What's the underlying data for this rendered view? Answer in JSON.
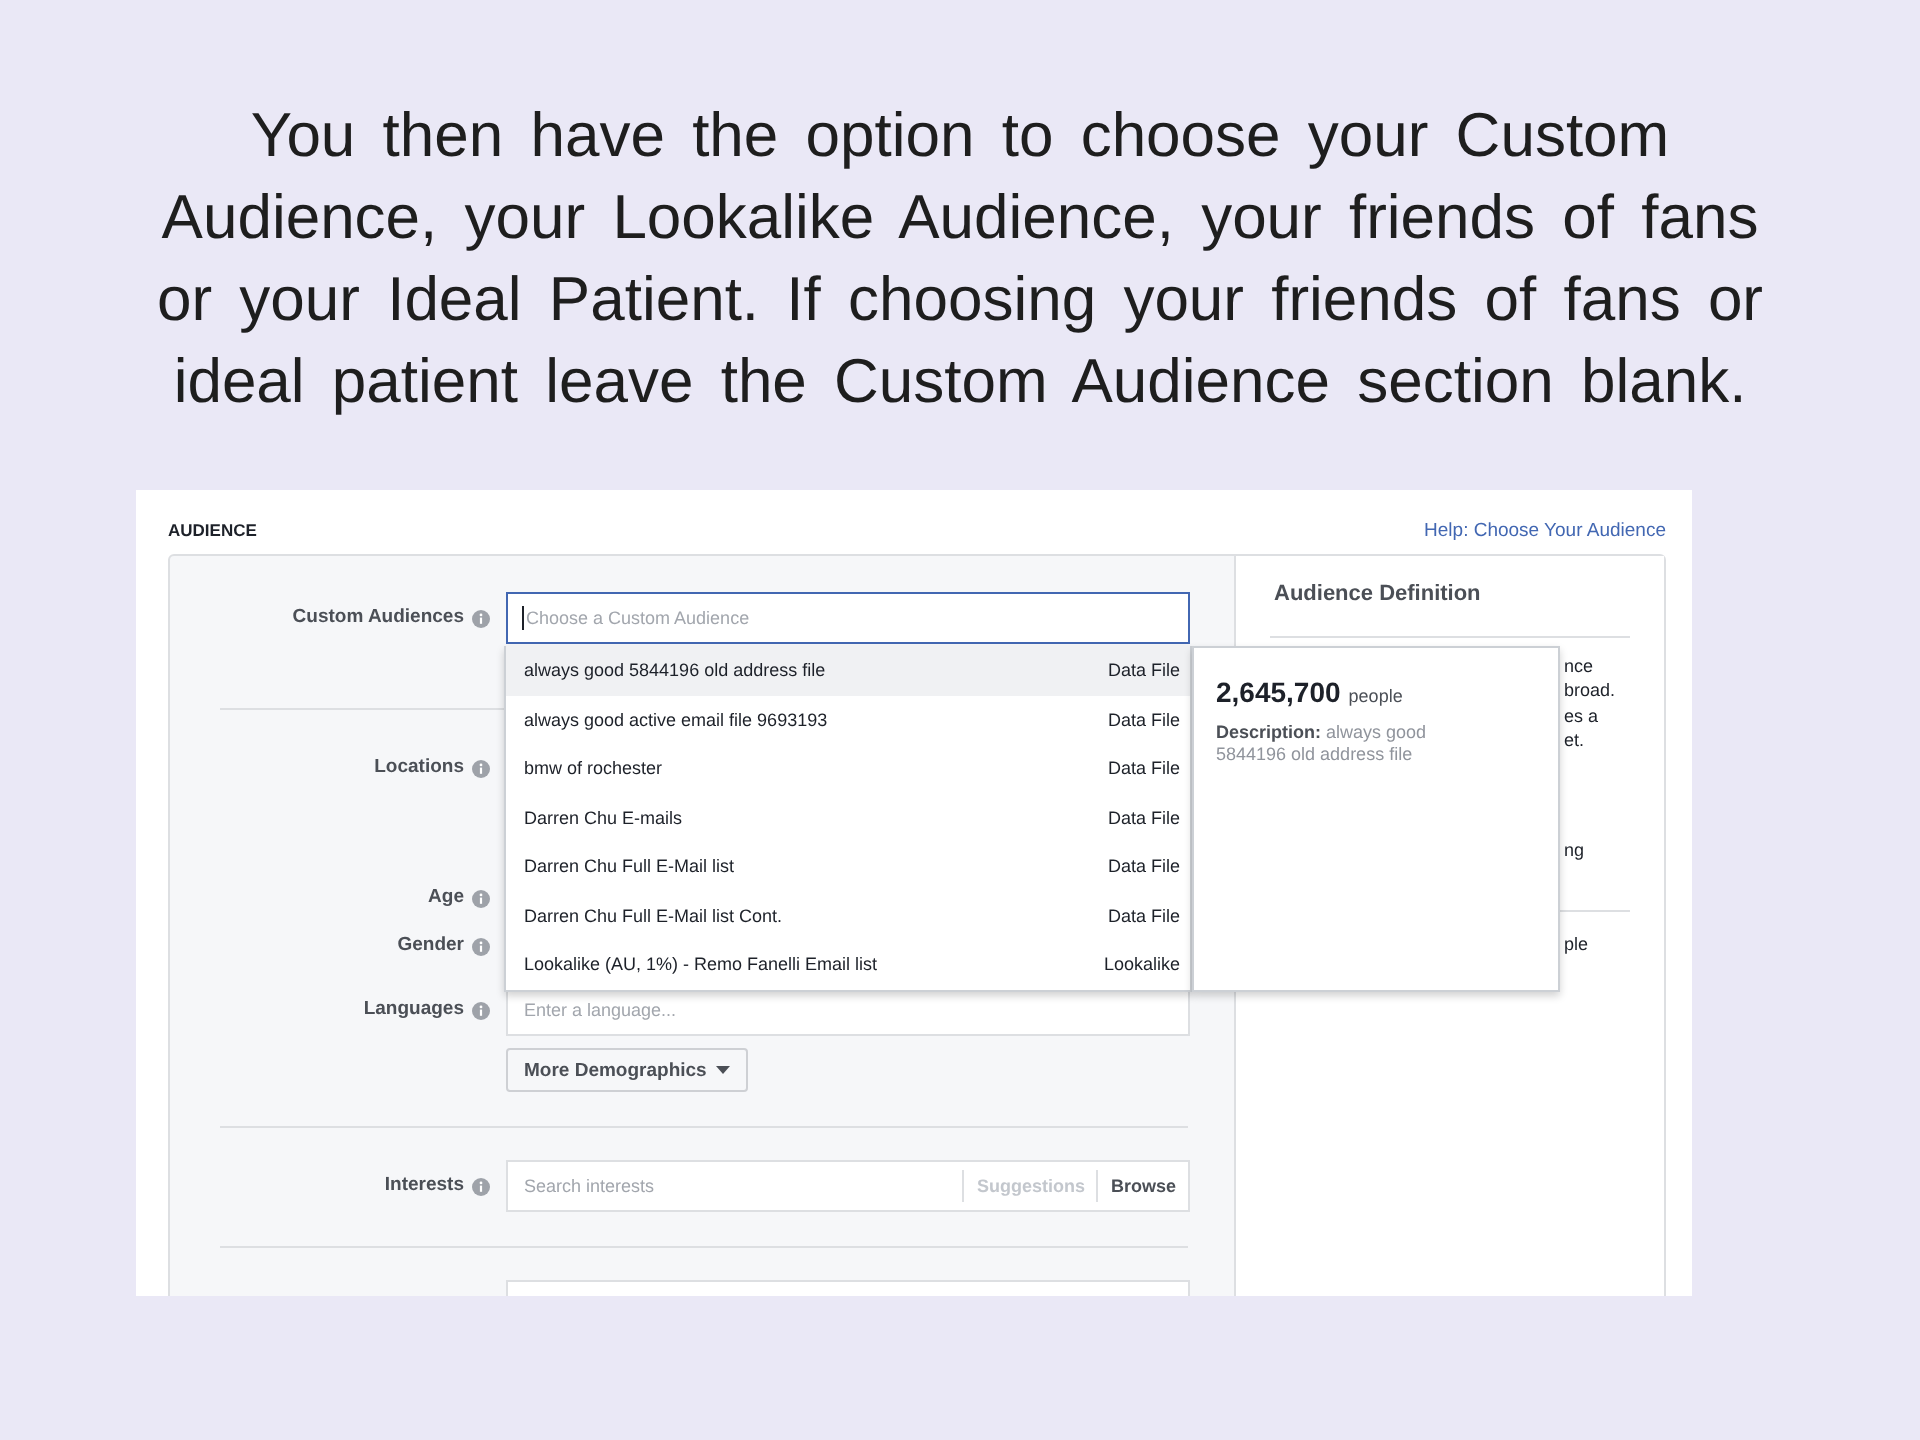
{
  "heading": "You then have the option to choose your Custom Audience, your Lookalike Audience, your friends of fans or your Ideal Patient. If choosing your friends of fans or ideal patient leave the Custom Audience section blank.",
  "screenshot": {
    "section_title": "AUDIENCE",
    "help_link": "Help: Choose Your Audience",
    "form_sections": [
      {
        "rows": [
          {
            "kind": "combobox",
            "label": "Custom Audiences",
            "placeholder": "Choose a Custom Audience",
            "focused": true,
            "options": [
              {
                "name": "always good 5844196 old address file",
                "type": "Data File",
                "selected": true
              },
              {
                "name": "always good active email file 9693193",
                "type": "Data File",
                "selected": false
              },
              {
                "name": "bmw of rochester",
                "type": "Data File",
                "selected": false
              },
              {
                "name": "Darren Chu E-mails",
                "type": "Data File",
                "selected": false
              },
              {
                "name": "Darren Chu Full E-Mail list",
                "type": "Data File",
                "selected": false
              },
              {
                "name": "Darren Chu Full E-Mail list Cont.",
                "type": "Data File",
                "selected": false
              },
              {
                "name": "Lookalike (AU, 1%) - Remo Fanelli Email list",
                "type": "Lookalike",
                "selected": false
              }
            ],
            "detail": {
              "count": "2,645,700",
              "unit": "people",
              "description": "**Description:** always good 5844196 old address file"
            }
          }
        ]
      },
      {
        "rows": [
          {
            "kind": "covered",
            "label": "Locations"
          },
          {
            "kind": "covered",
            "label": "Age"
          },
          {
            "kind": "covered",
            "label": "Gender"
          },
          {
            "kind": "input",
            "label": "Languages",
            "placeholder": "Enter a language..."
          },
          {
            "kind": "menu_button",
            "text": "More Demographics"
          }
        ]
      },
      {
        "rows": [
          {
            "kind": "search_browse",
            "label": "Interests",
            "placeholder": "Search interests",
            "actions": [
              {
                "text": "Suggestions",
                "disabled": true
              },
              {
                "text": "Browse",
                "disabled": false
              }
            ]
          }
        ]
      },
      {
        "rows": [
          {
            "kind": "clipped"
          }
        ]
      }
    ],
    "definition": {
      "title": "Audience Definition",
      "sections": [
        {
          "paragraphs": [
            [
              "nce",
              "broad.",
              "es a",
              "et."
            ],
            [
              "ng"
            ]
          ]
        },
        {
          "paragraphs": [
            [
              "ple"
            ]
          ]
        }
      ]
    }
  }
}
